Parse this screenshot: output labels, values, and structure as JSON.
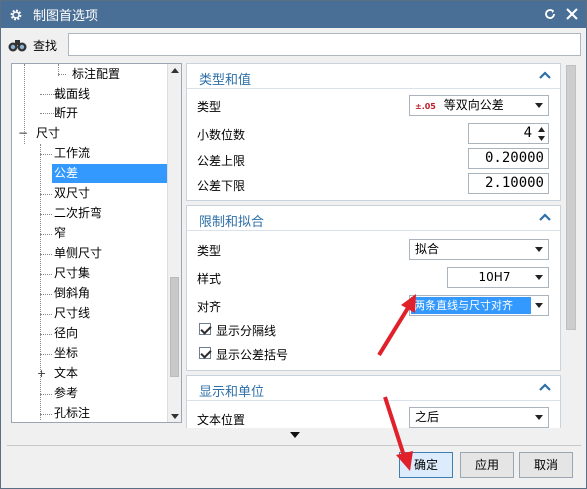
{
  "window": {
    "title": "制图首选项"
  },
  "search": {
    "label": "查找",
    "value": ""
  },
  "tree": {
    "items": [
      {
        "label": "标注配置",
        "level": 3
      },
      {
        "label": "截面线",
        "level": 2
      },
      {
        "label": "断开",
        "level": 2
      },
      {
        "label": "尺寸",
        "level": 1,
        "expander": "−"
      },
      {
        "label": "工作流",
        "level": 2
      },
      {
        "label": "公差",
        "level": 2,
        "selected": true
      },
      {
        "label": "双尺寸",
        "level": 2
      },
      {
        "label": "二次折弯",
        "level": 2
      },
      {
        "label": "窄",
        "level": 2
      },
      {
        "label": "单侧尺寸",
        "level": 2
      },
      {
        "label": "尺寸集",
        "level": 2
      },
      {
        "label": "倒斜角",
        "level": 2
      },
      {
        "label": "尺寸线",
        "level": 2
      },
      {
        "label": "径向",
        "level": 2
      },
      {
        "label": "坐标",
        "level": 2
      },
      {
        "label": "文本",
        "level": 2,
        "expander": "+"
      },
      {
        "label": "参考",
        "level": 2
      },
      {
        "label": "孔标注",
        "level": 2
      }
    ]
  },
  "panels": {
    "type_value": {
      "title": "类型和值",
      "type_label": "类型",
      "type_value": "等双向公差",
      "type_icon_text": "±.05",
      "decimals_label": "小数位数",
      "decimals_value": "4",
      "upper_label": "公差上限",
      "upper_value": "0.20000",
      "lower_label": "公差下限",
      "lower_value": "2.10000"
    },
    "limits_fits": {
      "title": "限制和拟合",
      "type_label": "类型",
      "type_value": "拟合",
      "style_label": "样式",
      "style_value": "10H7",
      "align_label": "对齐",
      "align_value": "两条直线与尺寸对齐",
      "show_separator_label": "显示分隔线",
      "show_separator_checked": true,
      "show_brackets_label": "显示公差括号",
      "show_brackets_checked": true
    },
    "display_units": {
      "title": "显示和单位",
      "text_pos_label": "文本位置",
      "text_pos_value": "之后"
    }
  },
  "buttons": {
    "ok": "确定",
    "apply": "应用",
    "cancel": "取消"
  },
  "colors": {
    "titlebar": "#4a6f96",
    "selection": "#3399ff",
    "section_title": "#2d6fa8",
    "annotation_arrow": "#e0202a"
  }
}
